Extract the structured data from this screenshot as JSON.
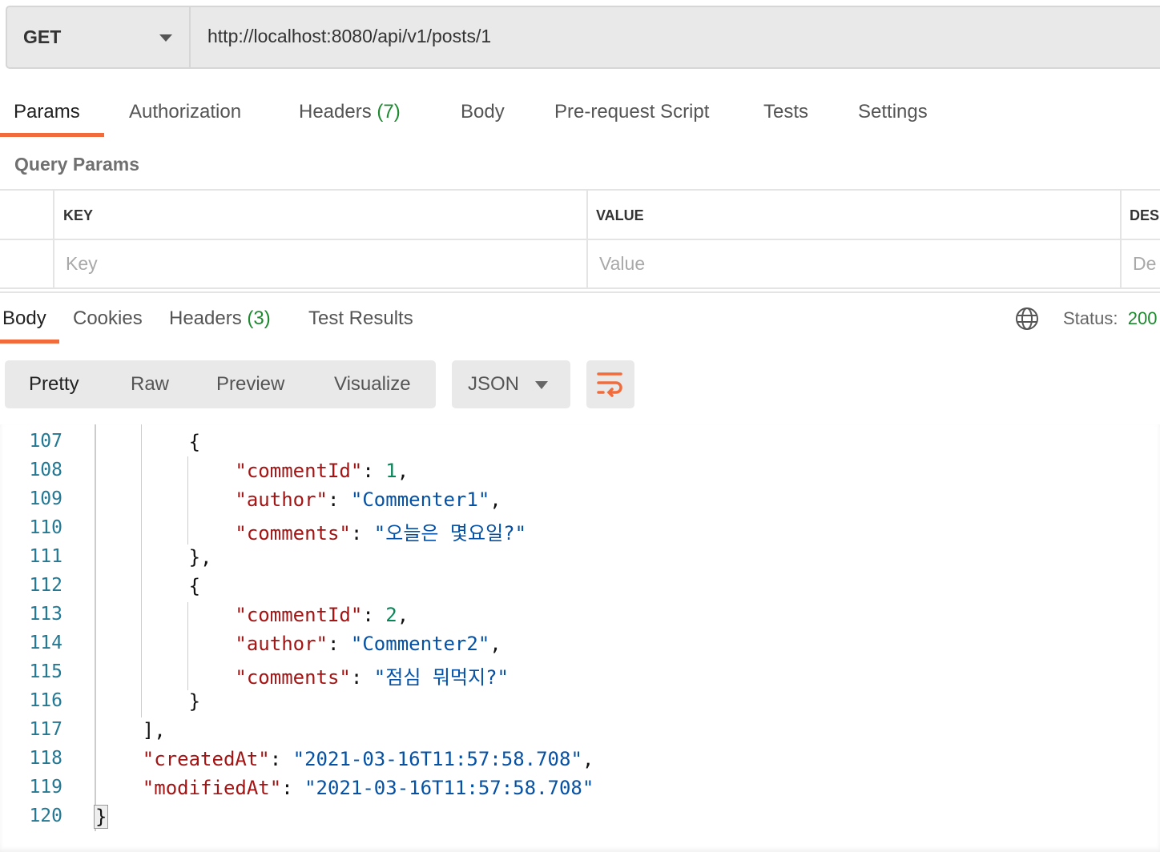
{
  "request": {
    "method": "GET",
    "url": "http://localhost:8080/api/v1/posts/1"
  },
  "request_tabs": [
    {
      "label": "Params",
      "count": ""
    },
    {
      "label": "Authorization",
      "count": ""
    },
    {
      "label": "Headers",
      "count": "(7)"
    },
    {
      "label": "Body",
      "count": ""
    },
    {
      "label": "Pre-request Script",
      "count": ""
    },
    {
      "label": "Tests",
      "count": ""
    },
    {
      "label": "Settings",
      "count": ""
    }
  ],
  "query_params": {
    "title": "Query Params",
    "columns": [
      "KEY",
      "VALUE",
      "DES"
    ],
    "placeholders": [
      "Key",
      "Value",
      "De"
    ]
  },
  "response_tabs": [
    {
      "label": "Body",
      "count": ""
    },
    {
      "label": "Cookies",
      "count": ""
    },
    {
      "label": "Headers",
      "count": "(3)"
    },
    {
      "label": "Test Results",
      "count": ""
    }
  ],
  "status": {
    "label": "Status:",
    "value": "200"
  },
  "view_modes": [
    "Pretty",
    "Raw",
    "Preview",
    "Visualize"
  ],
  "format": "JSON",
  "icons": {
    "globe": "globe-icon",
    "wrap": "wrap-lines-icon"
  },
  "colors": {
    "accent": "#f26b3a",
    "success": "#1d8a2f",
    "key": "#a31515",
    "string": "#0451a5",
    "number": "#098658"
  },
  "code": [
    {
      "n": "107",
      "i": 8,
      "tokens": [
        [
          "p",
          "{"
        ]
      ]
    },
    {
      "n": "108",
      "i": 12,
      "tokens": [
        [
          "k",
          "\"commentId\""
        ],
        [
          "p",
          ": "
        ],
        [
          "n",
          "1"
        ],
        [
          "p",
          ","
        ]
      ]
    },
    {
      "n": "109",
      "i": 12,
      "tokens": [
        [
          "k",
          "\"author\""
        ],
        [
          "p",
          ": "
        ],
        [
          "s",
          "\"Commenter1\""
        ],
        [
          "p",
          ","
        ]
      ]
    },
    {
      "n": "110",
      "i": 12,
      "tokens": [
        [
          "k",
          "\"comments\""
        ],
        [
          "p",
          ": "
        ],
        [
          "s",
          "\"오늘은 몇요일?\""
        ]
      ]
    },
    {
      "n": "111",
      "i": 8,
      "tokens": [
        [
          "p",
          "},"
        ]
      ]
    },
    {
      "n": "112",
      "i": 8,
      "tokens": [
        [
          "p",
          "{"
        ]
      ]
    },
    {
      "n": "113",
      "i": 12,
      "tokens": [
        [
          "k",
          "\"commentId\""
        ],
        [
          "p",
          ": "
        ],
        [
          "n",
          "2"
        ],
        [
          "p",
          ","
        ]
      ]
    },
    {
      "n": "114",
      "i": 12,
      "tokens": [
        [
          "k",
          "\"author\""
        ],
        [
          "p",
          ": "
        ],
        [
          "s",
          "\"Commenter2\""
        ],
        [
          "p",
          ","
        ]
      ]
    },
    {
      "n": "115",
      "i": 12,
      "tokens": [
        [
          "k",
          "\"comments\""
        ],
        [
          "p",
          ": "
        ],
        [
          "s",
          "\"점심 뭐먹지?\""
        ]
      ]
    },
    {
      "n": "116",
      "i": 8,
      "tokens": [
        [
          "p",
          "}"
        ]
      ]
    },
    {
      "n": "117",
      "i": 4,
      "tokens": [
        [
          "p",
          "],"
        ]
      ]
    },
    {
      "n": "118",
      "i": 4,
      "tokens": [
        [
          "k",
          "\"createdAt\""
        ],
        [
          "p",
          ": "
        ],
        [
          "s",
          "\"2021-03-16T11:57:58.708\""
        ],
        [
          "p",
          ","
        ]
      ]
    },
    {
      "n": "119",
      "i": 4,
      "tokens": [
        [
          "k",
          "\"modifiedAt\""
        ],
        [
          "p",
          ": "
        ],
        [
          "s",
          "\"2021-03-16T11:57:58.708\""
        ]
      ]
    },
    {
      "n": "120",
      "i": 0,
      "tokens": [
        [
          "p",
          "}"
        ]
      ]
    }
  ]
}
